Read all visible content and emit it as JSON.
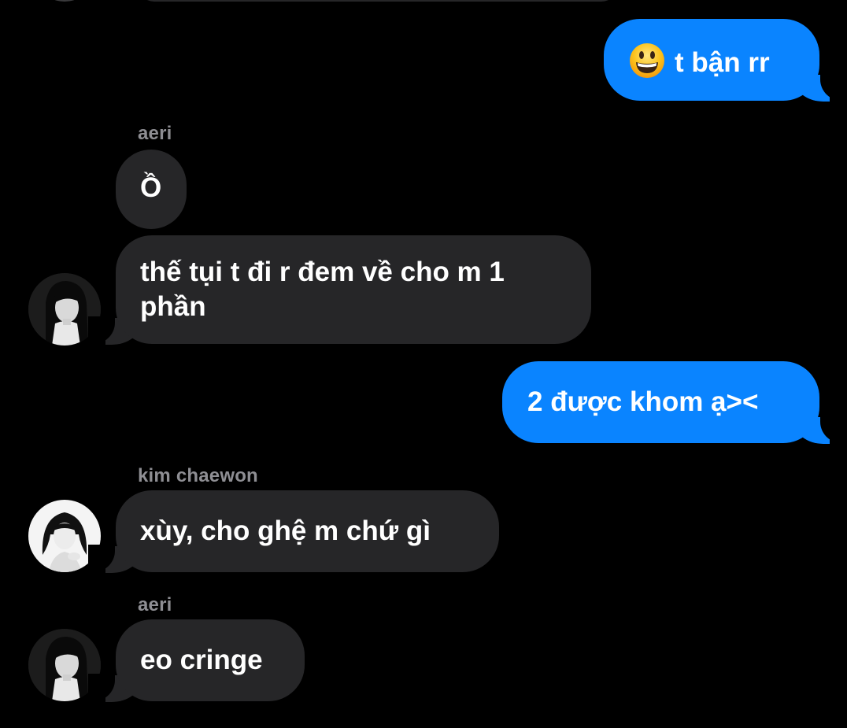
{
  "conversation": {
    "messages": [
      {
        "id": "m1",
        "direction": "outgoing",
        "emoji": "grinning-face-emoji",
        "text": "t bận rr"
      },
      {
        "id": "m2",
        "direction": "incoming",
        "sender": "aeri",
        "text": "Ồ"
      },
      {
        "id": "m3",
        "direction": "incoming",
        "text": "thế tụi t đi r đem về cho m 1\nphần",
        "avatar": "aeri-avatar"
      },
      {
        "id": "m4",
        "direction": "outgoing",
        "text": "2 được khom ạ><"
      },
      {
        "id": "m5",
        "direction": "incoming",
        "sender": "kim chaewon",
        "text": "xùy, cho ghệ m chứ gì",
        "avatar": "kim-chaewon-avatar"
      },
      {
        "id": "m6",
        "direction": "incoming",
        "sender": "aeri",
        "text": "eo cringe",
        "avatar": "aeri-avatar"
      }
    ]
  },
  "colors": {
    "background": "#000000",
    "incoming_bubble": "#262628",
    "outgoing_bubble": "#0a84ff",
    "sender_name": "#8e8e93",
    "message_text": "#ffffff"
  }
}
